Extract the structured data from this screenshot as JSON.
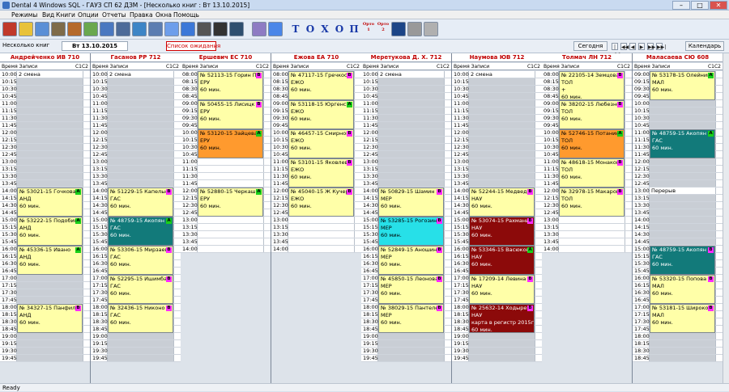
{
  "window": {
    "title": "Dental 4 Windows SQL - ГАУЗ СП 62 ДЗМ - [Несколько книг : Вт 13.10.2015]"
  },
  "menu": [
    "Режимы",
    "Вид",
    "Книги",
    "Опции",
    "Отчеты",
    "Правка",
    "Окна",
    "Помощь"
  ],
  "toolbar": {
    "letters": [
      "Т",
      "О",
      "Х",
      "О",
      "П"
    ],
    "orto1": "Орто\n1",
    "orto2": "Орто\n2",
    "icons": [
      "home-icon",
      "face-icon",
      "teeth-icon",
      "key-icon",
      "box-icon",
      "people-icon",
      "chart-icon",
      "list-icon",
      "grid-icon",
      "calendar-icon",
      "edit-icon",
      "arrows-icon",
      "zoom-icon",
      "binoculars-icon",
      "map-icon",
      "book-icon",
      "table-icon",
      "text-icon",
      "scissors-icon",
      "paste-icon"
    ]
  },
  "topbar": {
    "view_label": "Несколько книг",
    "date": "Вт 13.10.2015",
    "waitlist_button": "Список ожидания",
    "today_button": "Сегодня",
    "calendar_button": "Календарь",
    "nav": [
      "|◀◀",
      "◀◀",
      "◀",
      "▶",
      "▶▶",
      "▶▶|"
    ]
  },
  "column_header": {
    "time": "Время",
    "records": "Записи",
    "c1": "С1",
    "c2": "С2"
  },
  "doctors": [
    {
      "name": "Андрейченко ИВ 710",
      "rows": [
        "10:00",
        "10:15",
        "10:30",
        "10:45",
        "11:00",
        "11:15",
        "11:30",
        "11:45",
        "12:00",
        "12:15",
        "12:30",
        "12:45",
        "13:00",
        "13:15",
        "13:30",
        "13:45",
        "14:00",
        "14:15",
        "14:30",
        "14:45",
        "15:00",
        "15:15",
        "15:30",
        "15:45",
        "16:00",
        "16:15",
        "16:30",
        "16:45",
        "17:00",
        "17:15",
        "17:30",
        "17:45",
        "18:00",
        "18:15",
        "18:30",
        "18:45",
        "19:00",
        "19:15",
        "19:30",
        "19:45"
      ],
      "notes": [
        {
          "row": 0,
          "text": "2 смена"
        }
      ],
      "appts": [
        {
          "start": 16,
          "span": 4,
          "color": "yellow",
          "badge": "A",
          "badge_color": "green",
          "lines": [
            "№ 53021-15  Гочкова Т",
            "АНД",
            "60 мин."
          ]
        },
        {
          "start": 20,
          "span": 4,
          "color": "yellow",
          "badge": "A",
          "badge_color": "green",
          "lines": [
            "№ 53222-15  Подобин",
            "АНД",
            "60 мин."
          ]
        },
        {
          "start": 24,
          "span": 4,
          "color": "yellow",
          "badge": "A",
          "badge_color": "green",
          "lines": [
            "№ 45336-15  Ивано",
            "АНД",
            "60 мин."
          ]
        },
        {
          "start": 32,
          "span": 4,
          "color": "yellow",
          "badge": "B",
          "badge_color": "magenta",
          "lines": [
            "№ 34327-15  Панфило",
            "АНД",
            "60 мин."
          ]
        }
      ]
    },
    {
      "name": "Гасанов РР 712",
      "rows": [
        "10:00",
        "10:15",
        "10:30",
        "10:45",
        "11:00",
        "11:15",
        "11:30",
        "11:45",
        "12:00",
        "12:15",
        "12:30",
        "12:45",
        "13:00",
        "13:15",
        "13:30",
        "13:45",
        "14:00",
        "14:15",
        "14:30",
        "14:45",
        "15:00",
        "15:15",
        "15:30",
        "15:45",
        "16:00",
        "16:15",
        "16:30",
        "16:45",
        "17:00",
        "17:15",
        "17:30",
        "17:45",
        "18:00",
        "18:15",
        "18:30",
        "18:45",
        "19:00",
        "19:15",
        "19:30",
        "19:45"
      ],
      "notes": [
        {
          "row": 0,
          "text": "2 смена"
        }
      ],
      "appts": [
        {
          "start": 16,
          "span": 4,
          "color": "yellow",
          "badge": "B",
          "badge_color": "magenta",
          "lines": [
            "№ 51229-15  Капельн",
            "ГАС",
            "60 мин."
          ]
        },
        {
          "start": 20,
          "span": 4,
          "color": "teal",
          "badge": "A",
          "badge_color": "green",
          "lines": [
            "№ 48759-15  Акопян А",
            "ГАС",
            "60 мин."
          ]
        },
        {
          "start": 24,
          "span": 4,
          "color": "yellow",
          "badge": "B",
          "badge_color": "magenta",
          "lines": [
            "№ 53306-15  Мирзаева",
            "ГАС",
            "60 мин."
          ]
        },
        {
          "start": 28,
          "span": 4,
          "color": "yellow",
          "badge": "B",
          "badge_color": "magenta",
          "lines": [
            "№ 52295-15  Ишимба",
            "ГАС",
            "60 мин."
          ]
        },
        {
          "start": 32,
          "span": 4,
          "color": "yellow",
          "badge": "B",
          "badge_color": "magenta",
          "lines": [
            "№ 32436-15  Никоно",
            "ГАС",
            "60 мин."
          ]
        }
      ]
    },
    {
      "name": "Ершевич ЕС 710",
      "rows": [
        "08:00",
        "08:15",
        "08:30",
        "08:45",
        "09:00",
        "09:15",
        "09:30",
        "09:45",
        "10:00",
        "10:15",
        "10:30",
        "10:45",
        "11:00",
        "11:15",
        "11:30",
        "11:45",
        "12:00",
        "12:15",
        "12:30",
        "12:45",
        "13:00",
        "13:15",
        "13:30",
        "13:45",
        "14:00"
      ],
      "notes": [],
      "appts": [
        {
          "start": 0,
          "span": 4,
          "color": "yellow",
          "badge": "B",
          "badge_color": "magenta",
          "lines": [
            "№ 52113-15  Горин Па",
            "ЕРУ",
            "60 мин."
          ]
        },
        {
          "start": 4,
          "span": 4,
          "color": "yellow",
          "badge": "B",
          "badge_color": "magenta",
          "lines": [
            "№ 50455-15  Лисицк",
            "ЕРУ",
            "60 мин."
          ]
        },
        {
          "start": 8,
          "span": 4,
          "color": "orange",
          "badge": "A",
          "badge_color": "green",
          "lines": [
            "№ 53120-15  Зайцева",
            "ЕРУ",
            "60 мин."
          ]
        },
        {
          "start": 16,
          "span": 4,
          "color": "yellow",
          "badge": "A",
          "badge_color": "green",
          "lines": [
            "№ 52880-15  Черкаши",
            "ЕРУ",
            "60 мин."
          ]
        }
      ]
    },
    {
      "name": "Ежова ЕА 710",
      "rows": [
        "08:00",
        "08:15",
        "08:30",
        "08:45",
        "09:00",
        "09:15",
        "09:30",
        "09:45",
        "10:00",
        "10:15",
        "10:30",
        "10:45",
        "11:00",
        "11:15",
        "11:30",
        "11:45",
        "12:00",
        "12:15",
        "12:30",
        "12:45",
        "13:00",
        "13:15",
        "13:30",
        "13:45",
        "14:00"
      ],
      "notes": [],
      "appts": [
        {
          "start": 0,
          "span": 4,
          "color": "yellow",
          "badge": "B",
          "badge_color": "magenta",
          "lines": [
            "№ 47117-15  Гречкос",
            "ЕЖО",
            "60 мин."
          ]
        },
        {
          "start": 4,
          "span": 4,
          "color": "yellow",
          "badge": "A",
          "badge_color": "green",
          "lines": [
            "№ 53118-15  Юргенсо",
            "ЕЖО",
            "60 мин."
          ]
        },
        {
          "start": 8,
          "span": 4,
          "color": "yellow",
          "badge": "B",
          "badge_color": "magenta",
          "lines": [
            "№ 46457-15  Смирнов",
            "ЕЖО",
            "60 мин."
          ]
        },
        {
          "start": 12,
          "span": 4,
          "color": "yellow",
          "badge": "B",
          "badge_color": "magenta",
          "lines": [
            "№ 53101-15  Яковлев",
            "ЕЖО",
            "60 мин."
          ]
        },
        {
          "start": 16,
          "span": 4,
          "color": "yellow",
          "badge": "B",
          "badge_color": "magenta",
          "lines": [
            "№ 45040-15  Ж Кучер",
            "ЕЖО",
            "60 мин."
          ]
        }
      ]
    },
    {
      "name": "Меретукова Д. Х. 712",
      "rows": [
        "10:00",
        "10:15",
        "10:30",
        "10:45",
        "11:00",
        "11:15",
        "11:30",
        "11:45",
        "12:00",
        "12:15",
        "12:30",
        "12:45",
        "13:00",
        "13:15",
        "13:30",
        "13:45",
        "14:00",
        "14:15",
        "14:30",
        "14:45",
        "15:00",
        "15:15",
        "15:30",
        "15:45",
        "16:00",
        "16:15",
        "16:30",
        "16:45",
        "17:00",
        "17:15",
        "17:30",
        "17:45",
        "18:00",
        "18:15",
        "18:30",
        "18:45",
        "19:00",
        "19:15",
        "19:30",
        "19:45"
      ],
      "notes": [
        {
          "row": 0,
          "text": "2 смена"
        }
      ],
      "appts": [
        {
          "start": 16,
          "span": 4,
          "color": "yellow",
          "badge": "B",
          "badge_color": "magenta",
          "lines": [
            "№ 50829-15  Шамин А",
            "МЕР",
            "60 мин."
          ]
        },
        {
          "start": 20,
          "span": 4,
          "color": "cyan",
          "badge": "B",
          "badge_color": "magenta",
          "lines": [
            "№ 53285-15  Рогозина",
            "МЕР",
            "60 мин."
          ]
        },
        {
          "start": 24,
          "span": 4,
          "color": "yellow",
          "badge": "B",
          "badge_color": "magenta",
          "lines": [
            "№ 52849-15  Аношина",
            "МЕР",
            "60 мин."
          ]
        },
        {
          "start": 28,
          "span": 4,
          "color": "yellow",
          "badge": "B",
          "badge_color": "magenta",
          "lines": [
            "№ 45850-15  Леонова",
            "МЕР",
            "60 мин."
          ]
        },
        {
          "start": 32,
          "span": 4,
          "color": "yellow",
          "badge": "B",
          "badge_color": "magenta",
          "lines": [
            "№ 38029-15  Пантеле",
            "МЕР",
            "60 мин."
          ]
        }
      ]
    },
    {
      "name": "Наумова ЮВ 712",
      "rows": [
        "10:00",
        "10:15",
        "10:30",
        "10:45",
        "11:00",
        "11:15",
        "11:30",
        "11:45",
        "12:00",
        "12:15",
        "12:30",
        "12:45",
        "13:00",
        "13:15",
        "13:30",
        "13:45",
        "14:00",
        "14:15",
        "14:30",
        "14:45",
        "15:00",
        "15:15",
        "15:30",
        "15:45",
        "16:00",
        "16:15",
        "16:30",
        "16:45",
        "17:00",
        "17:15",
        "17:30",
        "17:45",
        "18:00",
        "18:15",
        "18:30",
        "18:45",
        "19:00",
        "19:15",
        "19:30",
        "19:45"
      ],
      "notes": [
        {
          "row": 0,
          "text": "2 смена"
        }
      ],
      "appts": [
        {
          "start": 16,
          "span": 4,
          "color": "yellow",
          "badge": "B",
          "badge_color": "magenta",
          "lines": [
            "№ 52244-15  Медведе",
            "НАУ",
            "60 мин."
          ]
        },
        {
          "start": 20,
          "span": 4,
          "color": "darkred",
          "badge": "B",
          "badge_color": "magenta",
          "lines": [
            "№ 53074-15  Рахмани",
            "НАУ",
            "60 мин."
          ]
        },
        {
          "start": 24,
          "span": 4,
          "color": "darkred",
          "badge": "A",
          "badge_color": "green",
          "lines": [
            "№ 53346-15  Васюков",
            "НАУ",
            "60 мин."
          ]
        },
        {
          "start": 28,
          "span": 4,
          "color": "yellow",
          "badge": "B",
          "badge_color": "magenta",
          "lines": [
            "№ 17209-14  Левина Е",
            "НАУ",
            "60 мин."
          ]
        },
        {
          "start": 32,
          "span": 4,
          "color": "darkred",
          "badge": "B",
          "badge_color": "magenta",
          "lines": [
            "№ 25632-14  Ходырев",
            "НАУ",
            "карта в регистр 2015г",
            "60 мин."
          ]
        }
      ]
    },
    {
      "name": "Толмач ЛН 712",
      "rows": [
        "08:00",
        "08:15",
        "08:30",
        "08:45",
        "09:00",
        "09:15",
        "09:30",
        "09:45",
        "10:00",
        "10:15",
        "10:30",
        "10:45",
        "11:00",
        "11:15",
        "11:30",
        "11:45",
        "12:00",
        "12:15",
        "12:30",
        "12:45",
        "13:00",
        "13:15",
        "13:30",
        "13:45",
        "14:00"
      ],
      "notes": [],
      "appts": [
        {
          "start": 0,
          "span": 4,
          "color": "yellow",
          "badge": "B",
          "badge_color": "magenta",
          "lines": [
            "№ 22105-14  Земцова",
            "ТОЛ",
            "+",
            "60 мин."
          ]
        },
        {
          "start": 4,
          "span": 4,
          "color": "yellow",
          "badge": "B",
          "badge_color": "magenta",
          "lines": [
            "№ 38202-15  Любезно",
            "ТОЛ",
            "60 мин."
          ]
        },
        {
          "start": 8,
          "span": 4,
          "color": "orange",
          "badge": "A",
          "badge_color": "green",
          "lines": [
            "№ 52746-15  Потанин",
            "ТОЛ",
            "60 мин."
          ]
        },
        {
          "start": 12,
          "span": 4,
          "color": "yellow",
          "badge": "B",
          "badge_color": "magenta",
          "lines": [
            "№ 48618-15  Монаков",
            "ТОЛ",
            "60 мин."
          ]
        },
        {
          "start": 16,
          "span": 4,
          "color": "yellow",
          "badge": "B",
          "badge_color": "magenta",
          "lines": [
            "№ 32978-15  Макаров",
            "ТОЛ",
            "60 мин."
          ]
        }
      ]
    },
    {
      "name": "Малaсаева СЮ 608",
      "rows": [
        "09:00",
        "09:15",
        "09:30",
        "09:45",
        "10:00",
        "10:15",
        "10:30",
        "10:45",
        "11:00",
        "11:15",
        "11:30",
        "11:45",
        "12:00",
        "12:15",
        "12:30",
        "12:45",
        "13:00",
        "13:15",
        "13:30",
        "13:45",
        "14:00",
        "14:15",
        "14:30",
        "14:45",
        "15:00",
        "15:15",
        "15:30",
        "15:45",
        "16:00",
        "16:15",
        "16:30",
        "16:45",
        "17:00",
        "17:15",
        "17:30",
        "17:45",
        "18:00",
        "18:15",
        "18:30",
        "18:45"
      ],
      "notes": [
        {
          "row": 16,
          "text": "Перерыв"
        }
      ],
      "appts": [
        {
          "start": 0,
          "span": 4,
          "color": "yellow",
          "badge": "A",
          "badge_color": "green",
          "lines": [
            "№ 53178-15  Олейник",
            "МАЛ",
            "60 мин."
          ]
        },
        {
          "start": 8,
          "span": 4,
          "color": "teal",
          "badge": "A",
          "badge_color": "green",
          "lines": [
            "№ 48759-15  Акопян А",
            "ГАС",
            "60 мин."
          ]
        },
        {
          "start": 24,
          "span": 4,
          "color": "teal",
          "badge": "B",
          "badge_color": "magenta",
          "lines": [
            "№ 48759-15  Акопян А",
            "ГАС",
            "60 мин."
          ]
        },
        {
          "start": 28,
          "span": 4,
          "color": "yellow",
          "badge": "B",
          "badge_color": "magenta",
          "lines": [
            "№ 53320-15  Попова Л",
            "МАЛ",
            "60 мин."
          ]
        },
        {
          "start": 32,
          "span": 4,
          "color": "yellow",
          "badge": "B",
          "badge_color": "magenta",
          "lines": [
            "№ 53181-15  Широков",
            "МАЛ",
            "60 мин."
          ]
        }
      ]
    }
  ],
  "colors": {
    "yellow": "#ffffa8",
    "teal": "#127a7a",
    "orange": "#ff9a2e",
    "cyan": "#27e0e8",
    "darkred": "#8c0a0a",
    "green": "#19d019",
    "magenta": "#ff2bff",
    "free": "#ffffff",
    "busy": "#c9ced5"
  },
  "status": "Ready"
}
